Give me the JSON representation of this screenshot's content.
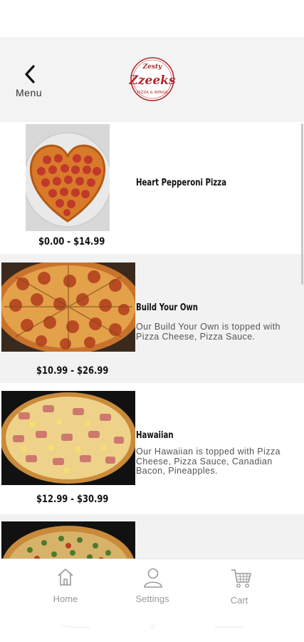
{
  "header": {
    "back_label": "Menu",
    "logo": {
      "top_text": "Zesty",
      "main_text": "Zzeeks",
      "bottom_text": "PIZZA & WINGS",
      "color": "#b0282e"
    }
  },
  "menu_items": [
    {
      "name": "Heart Pepperoni Pizza",
      "price": "$0.00 - $14.99",
      "description": "",
      "image": "heart-pepperoni-pizza-image"
    },
    {
      "name": "Build Your Own",
      "price": "$10.99 - $26.99",
      "description": "Our Build Your Own is topped with Pizza Cheese, Pizza Sauce.",
      "image": "build-your-own-pizza-image"
    },
    {
      "name": "Hawaiian",
      "price": "$12.99 - $30.99",
      "description": "Our Hawaiian is topped with Pizza Cheese, Pizza Sauce, Canadian Bacon, Pineapples.",
      "image": "hawaiian-pizza-image"
    }
  ],
  "bottom_nav": [
    {
      "label": "Home",
      "icon": "home-icon"
    },
    {
      "label": "Settings",
      "icon": "person-icon"
    },
    {
      "label": "Cart",
      "icon": "cart-icon"
    }
  ],
  "colors": {
    "header_bg": "#f3f3f3",
    "alt_row_bg": "#f2f2f2",
    "nav_text": "#999999"
  }
}
